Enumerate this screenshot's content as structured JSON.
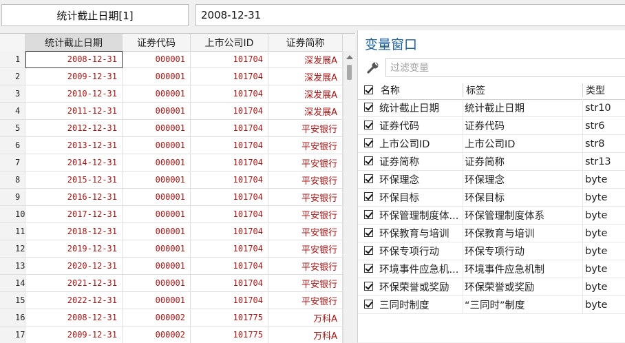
{
  "top": {
    "var_name": "统计截止日期[1]",
    "var_value": "2008-12-31"
  },
  "grid": {
    "columns": [
      "统计截止日期",
      "证券代码",
      "上市公司ID",
      "证券简称"
    ],
    "rows": [
      [
        "1",
        "2008-12-31",
        "000001",
        "101704",
        "深发展A"
      ],
      [
        "2",
        "2009-12-31",
        "000001",
        "101704",
        "深发展A"
      ],
      [
        "3",
        "2010-12-31",
        "000001",
        "101704",
        "深发展A"
      ],
      [
        "4",
        "2011-12-31",
        "000001",
        "101704",
        "深发展A"
      ],
      [
        "5",
        "2012-12-31",
        "000001",
        "101704",
        "平安银行"
      ],
      [
        "6",
        "2013-12-31",
        "000001",
        "101704",
        "平安银行"
      ],
      [
        "7",
        "2014-12-31",
        "000001",
        "101704",
        "平安银行"
      ],
      [
        "8",
        "2015-12-31",
        "000001",
        "101704",
        "平安银行"
      ],
      [
        "9",
        "2016-12-31",
        "000001",
        "101704",
        "平安银行"
      ],
      [
        "10",
        "2017-12-31",
        "000001",
        "101704",
        "平安银行"
      ],
      [
        "11",
        "2018-12-31",
        "000001",
        "101704",
        "平安银行"
      ],
      [
        "12",
        "2019-12-31",
        "000001",
        "101704",
        "平安银行"
      ],
      [
        "13",
        "2020-12-31",
        "000001",
        "101704",
        "平安银行"
      ],
      [
        "14",
        "2021-12-31",
        "000001",
        "101704",
        "平安银行"
      ],
      [
        "15",
        "2022-12-31",
        "000001",
        "101704",
        "平安银行"
      ],
      [
        "16",
        "2008-12-31",
        "000002",
        "101775",
        "万科A"
      ],
      [
        "17",
        "2009-12-31",
        "000002",
        "101775",
        "万科A"
      ]
    ]
  },
  "variables": {
    "title": "变量窗口",
    "filter_placeholder": "过滤变量",
    "headers": {
      "name": "名称",
      "label": "标签",
      "type": "类型"
    },
    "items": [
      {
        "name": "统计截止日期",
        "label": "统计截止日期",
        "type": "str10"
      },
      {
        "name": "证券代码",
        "label": "证券代码",
        "type": "str6"
      },
      {
        "name": "上市公司ID",
        "label": "上市公司ID",
        "type": "str8"
      },
      {
        "name": "证券简称",
        "label": "证券简称",
        "type": "str13"
      },
      {
        "name": "环保理念",
        "label": "环保理念",
        "type": "byte"
      },
      {
        "name": "环保目标",
        "label": "环保目标",
        "type": "byte"
      },
      {
        "name": "环保管理制度体...",
        "label": "环保管理制度体系",
        "type": "byte"
      },
      {
        "name": "环保教育与培训",
        "label": "环保教育与培训",
        "type": "byte"
      },
      {
        "name": "环保专项行动",
        "label": "环保专项行动",
        "type": "byte"
      },
      {
        "name": "环境事件应急机...",
        "label": "环境事件应急机制",
        "type": "byte"
      },
      {
        "name": "环保荣誉或奖励",
        "label": "环保荣誉或奖励",
        "type": "byte"
      },
      {
        "name": "三同时制度",
        "label": "“三同时”制度",
        "type": "byte"
      }
    ]
  },
  "colors": {
    "data_text": "#a31515",
    "title_blue": "#1d5f9a"
  }
}
